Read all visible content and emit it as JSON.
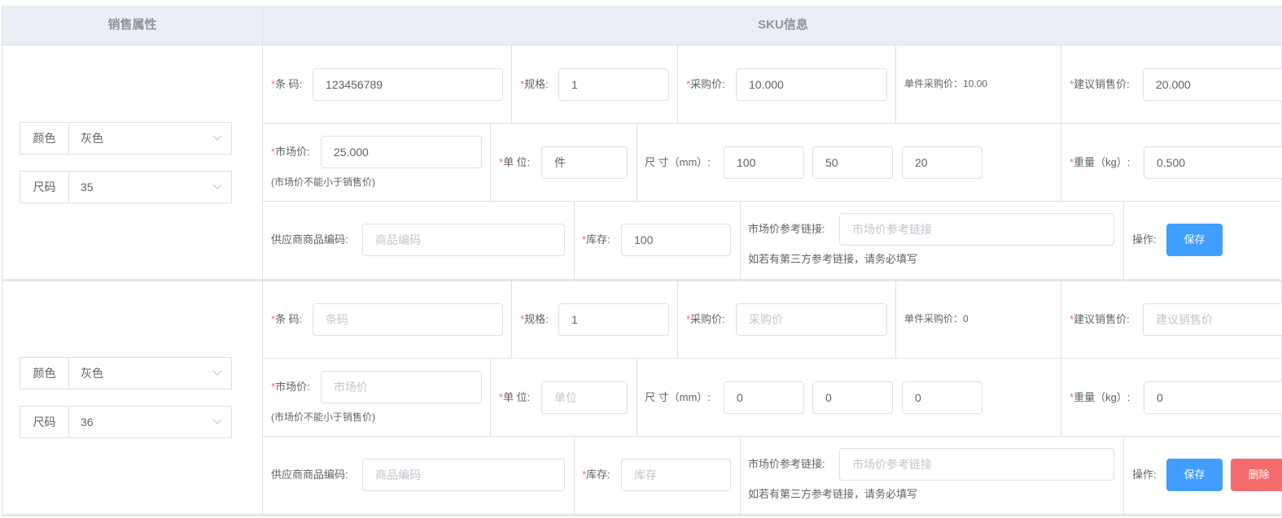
{
  "header": {
    "sales_attrs": "销售属性",
    "sku_info": "SKU信息"
  },
  "labels": {
    "barcode": "条 码:",
    "spec": "规格:",
    "purchase_price": "采购价:",
    "unit_purchase_price": "单件采购价：",
    "suggested_price": "建议销售价:",
    "market_price": "市场价:",
    "market_price_note": "(市场价不能小于销售价)",
    "unit": "单 位:",
    "size": "尺 寸（mm）:",
    "weight": "重量（kg）:",
    "supplier_code": "供应商商品编码:",
    "stock": "库存:",
    "ref_link": "市场价参考链接:",
    "ref_link_note": "如若有第三方参考链接，请务必填写",
    "ops": "操作:",
    "save": "保存",
    "delete": "删除",
    "required_mark": "*"
  },
  "placeholders": {
    "barcode": "条码",
    "purchase_price": "采购价",
    "suggested_price": "建议销售价",
    "market_price": "市场价",
    "unit": "单位",
    "supplier_code": "商品编码",
    "stock": "库存",
    "ref_link": "市场价参考链接"
  },
  "rows": [
    {
      "attrs": [
        {
          "name": "颜色",
          "value": "灰色"
        },
        {
          "name": "尺码",
          "value": "35"
        }
      ],
      "barcode": "123456789",
      "spec": "1",
      "purchase_price": "10.000",
      "unit_purchase_price": "10.00",
      "suggested_price": "20.000",
      "market_price": "25.000",
      "unit": "件",
      "size": [
        "100",
        "50",
        "20"
      ],
      "weight": "0.500",
      "supplier_code": "",
      "stock": "100",
      "ref_link": "",
      "can_delete": false
    },
    {
      "attrs": [
        {
          "name": "颜色",
          "value": "灰色"
        },
        {
          "name": "尺码",
          "value": "36"
        }
      ],
      "barcode": "",
      "spec": "1",
      "purchase_price": "",
      "unit_purchase_price": "0",
      "suggested_price": "",
      "market_price": "",
      "unit": "",
      "size": [
        "0",
        "0",
        "0"
      ],
      "weight": "0",
      "supplier_code": "",
      "stock": "",
      "ref_link": "",
      "can_delete": true
    }
  ],
  "colors": {
    "required": "#f56c6c",
    "primary": "#409eff",
    "danger": "#f56c6c",
    "border": "#dcdfe6",
    "header_bg": "#ebeef5"
  }
}
